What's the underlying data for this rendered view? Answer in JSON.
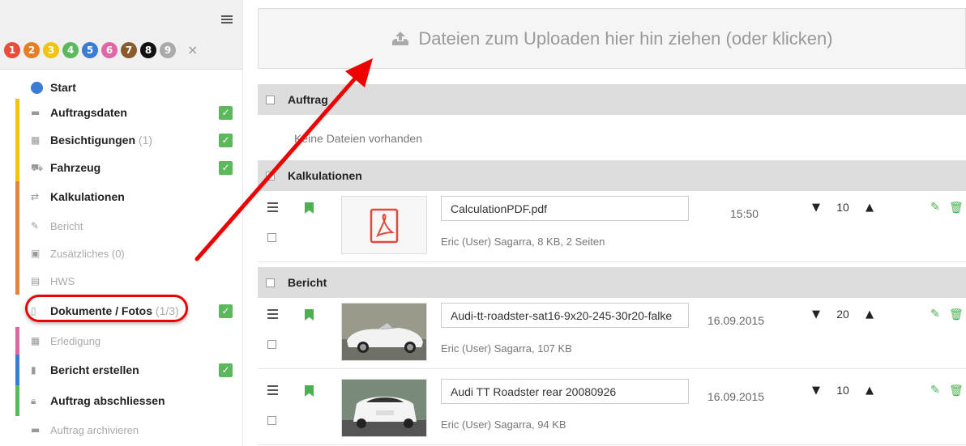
{
  "sidebar": {
    "steps": [
      {
        "n": "1",
        "color": "#e74c3c"
      },
      {
        "n": "2",
        "color": "#e67e22"
      },
      {
        "n": "3",
        "color": "#f1c40f"
      },
      {
        "n": "4",
        "color": "#5cb85c"
      },
      {
        "n": "5",
        "color": "#3a7bd5"
      },
      {
        "n": "6",
        "color": "#e066a6"
      },
      {
        "n": "7",
        "color": "#8b5a2b"
      },
      {
        "n": "8",
        "color": "#111111"
      },
      {
        "n": "9",
        "color": "#aaaaaa"
      }
    ],
    "close_symbol": "×",
    "items": [
      {
        "label": "Start",
        "count": ""
      },
      {
        "label": "Auftragsdaten",
        "count": ""
      },
      {
        "label": "Besichtigungen",
        "count": "(1)"
      },
      {
        "label": "Fahrzeug",
        "count": ""
      },
      {
        "label": "Kalkulationen",
        "count": ""
      },
      {
        "label": "Bericht",
        "count": ""
      },
      {
        "label": "Zusätzliches (0)",
        "count": ""
      },
      {
        "label": "HWS",
        "count": ""
      },
      {
        "label": "Dokumente / Fotos",
        "count": "(1/3)"
      },
      {
        "label": "Erledigung",
        "count": ""
      },
      {
        "label": "Bericht erstellen",
        "count": ""
      },
      {
        "label": "Auftrag abschliessen",
        "count": ""
      },
      {
        "label": "Auftrag archivieren",
        "count": ""
      }
    ]
  },
  "upload": {
    "text": "Dateien zum Uploaden hier hin ziehen (oder klicken)"
  },
  "sections": {
    "auftrag": {
      "title": "Auftrag",
      "empty": "Keine Dateien vorhanden"
    },
    "kalkulationen": {
      "title": "Kalkulationen"
    },
    "bericht": {
      "title": "Bericht"
    }
  },
  "files": [
    {
      "name": "CalculationPDF.pdf",
      "meta": "Eric (User) Sagarra, 8 KB, 2 Seiten",
      "time": "15:50",
      "order": "10"
    },
    {
      "name": "Audi-tt-roadster-sat16-9x20-245-30r20-falke",
      "meta": "Eric (User) Sagarra, 107 KB",
      "date": "16.09.2015",
      "order": "20"
    },
    {
      "name": "Audi TT Roadster rear 20080926",
      "meta": "Eric (User) Sagarra, 94 KB",
      "date": "16.09.2015",
      "order": "10"
    }
  ],
  "colors": {
    "accent_red": "#e00000",
    "check_green": "#5cb85c"
  }
}
